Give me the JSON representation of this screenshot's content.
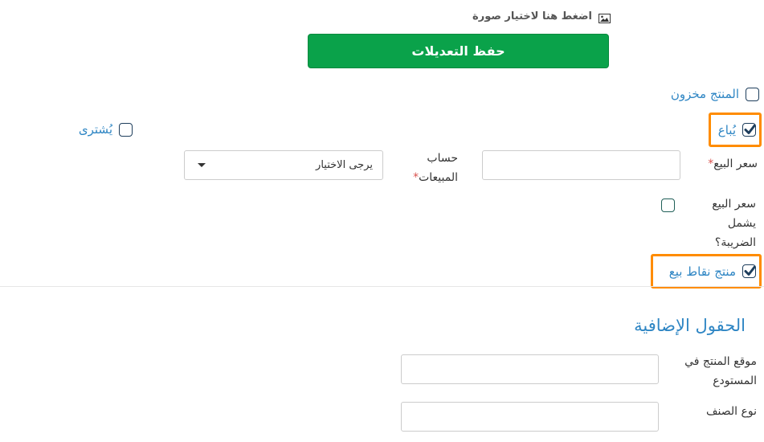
{
  "image_upload": {
    "label": "اضغط هنا لاختيار صورة",
    "icon": "image-icon"
  },
  "save_button": {
    "label": "حفظ التعديلات",
    "color": "#0aa24a"
  },
  "stored_product": {
    "label": "المنتج مخزون",
    "checked": false
  },
  "sold": {
    "label": "يُباع",
    "checked": true
  },
  "bought": {
    "label": "يُشترى",
    "checked": false
  },
  "sell_price": {
    "label": "سعر البيع",
    "required_mark": "*",
    "value": ""
  },
  "sales_account": {
    "label": "حساب المبيعات",
    "required_mark": "*",
    "selected": "يرجى الاختيار"
  },
  "tax_inclusive": {
    "label": "سعر البيع يشمل الضريبة؟",
    "checked": false
  },
  "pos_product": {
    "label": "منتج نقاط بيع",
    "checked": true
  },
  "additional_fields": {
    "title": "الحقول الإضافية",
    "warehouse_location": {
      "label": "موقع المنتج في المستودع",
      "value": ""
    },
    "item_type": {
      "label": "نوع الصنف",
      "value": ""
    }
  },
  "colors": {
    "link": "#2f86c4",
    "highlight": "#ff8c00",
    "required": "#d9534f"
  }
}
